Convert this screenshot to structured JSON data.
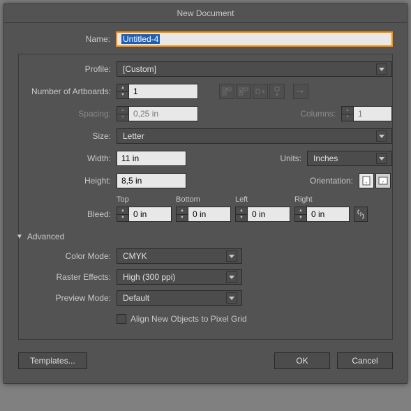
{
  "title": "New Document",
  "name": {
    "label": "Name:",
    "value": "Untitled-4"
  },
  "profile": {
    "label": "Profile:",
    "value": "[Custom]"
  },
  "artboards": {
    "label": "Number of Artboards:",
    "value": "1"
  },
  "spacing": {
    "label": "Spacing:",
    "value": "0,25 in"
  },
  "columns": {
    "label": "Columns:",
    "value": "1"
  },
  "size": {
    "label": "Size:",
    "value": "Letter"
  },
  "width": {
    "label": "Width:",
    "value": "11 in"
  },
  "height": {
    "label": "Height:",
    "value": "8,5 in"
  },
  "units": {
    "label": "Units:",
    "value": "Inches"
  },
  "orientation": {
    "label": "Orientation:"
  },
  "bleed": {
    "label": "Bleed:",
    "top": {
      "label": "Top",
      "value": "0 in"
    },
    "bottom": {
      "label": "Bottom",
      "value": "0 in"
    },
    "left": {
      "label": "Left",
      "value": "0 in"
    },
    "right": {
      "label": "Right",
      "value": "0 in"
    }
  },
  "advanced": {
    "label": "Advanced",
    "colorMode": {
      "label": "Color Mode:",
      "value": "CMYK"
    },
    "rasterEffects": {
      "label": "Raster Effects:",
      "value": "High (300 ppi)"
    },
    "previewMode": {
      "label": "Preview Mode:",
      "value": "Default"
    },
    "align": {
      "label": "Align New Objects to Pixel Grid"
    }
  },
  "buttons": {
    "templates": "Templates...",
    "ok": "OK",
    "cancel": "Cancel"
  }
}
